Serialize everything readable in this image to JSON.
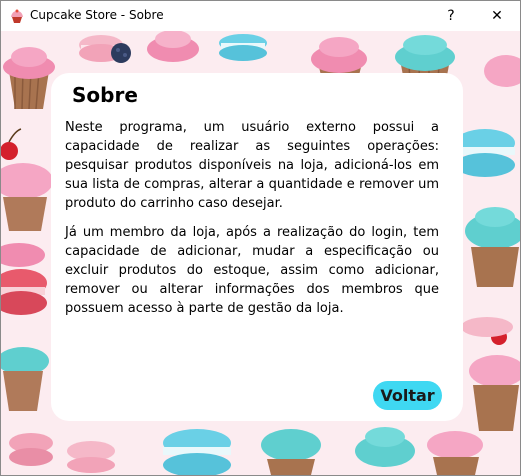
{
  "window": {
    "title": "Cupcake Store - Sobre",
    "help_glyph": "?",
    "close_glyph": "✕"
  },
  "panel": {
    "title": "Sobre",
    "paragraph1": "Neste programa, um usuário externo possui a capacidade de realizar as seguintes operações: pesquisar produtos disponíveis na loja, adicioná-los em sua lista de compras, alterar a quantidade e remover um produto do carrinho caso desejar.",
    "paragraph2": "Já um membro da loja, após a realização do login, tem capacidade de adicionar, mudar a especificação ou excluir produtos do estoque, assim como adicionar, remover ou alterar informações dos membros que possuem acesso à parte de gestão da loja.",
    "back_button": "Voltar"
  },
  "colors": {
    "background": "#fcecf0",
    "accent_button": "#3fd8f2",
    "cupcake_teal": "#5fcfcf",
    "cupcake_pink": "#f07ea0",
    "cupcake_wrapper": "#b07a5a",
    "macaron_blue": "#6ad0e6"
  },
  "decor": {
    "icons": [
      "cupcake-icon",
      "macaron-icon",
      "berry-icon",
      "cherry-icon"
    ]
  }
}
